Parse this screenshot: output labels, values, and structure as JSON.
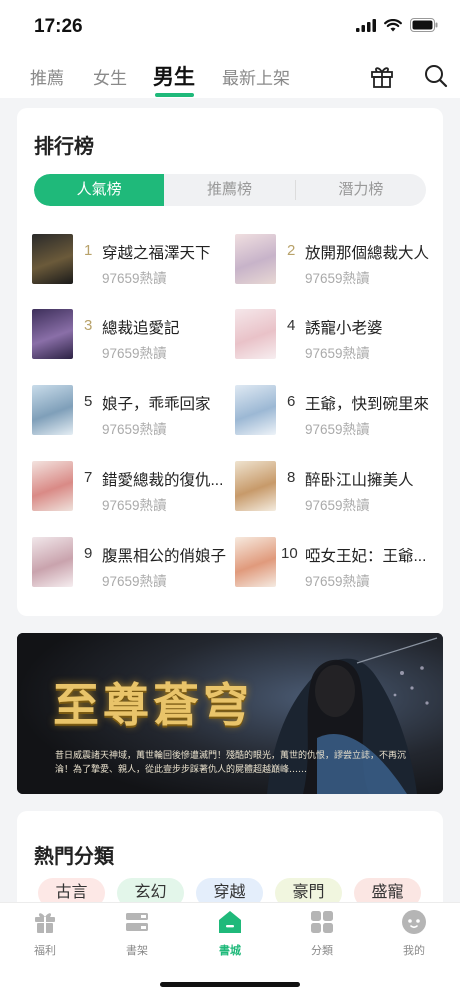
{
  "status": {
    "time": "17:26"
  },
  "top_tabs": [
    {
      "label": "推薦",
      "active": false
    },
    {
      "label": "女生",
      "active": false
    },
    {
      "label": "男生",
      "active": true
    },
    {
      "label": "最新上架",
      "active": false
    }
  ],
  "top_icons": [
    "gift-icon",
    "search-icon"
  ],
  "ranking": {
    "title": "排行榜",
    "segments": [
      {
        "label": "人氣榜",
        "active": true
      },
      {
        "label": "推薦榜",
        "active": false
      },
      {
        "label": "潛力榜",
        "active": false
      }
    ],
    "items": [
      {
        "rank": "1",
        "name": "穿越之福澤天下",
        "reads": "97659熱讀"
      },
      {
        "rank": "2",
        "name": "放開那個總裁大人",
        "reads": "97659熱讀"
      },
      {
        "rank": "3",
        "name": "總裁追愛記",
        "reads": "97659熱讀"
      },
      {
        "rank": "4",
        "name": "誘寵小老婆",
        "reads": "97659熱讀"
      },
      {
        "rank": "5",
        "name": "娘子，乖乖回家",
        "reads": "97659熱讀"
      },
      {
        "rank": "6",
        "name": "王爺，快到碗里來",
        "reads": "97659熱讀"
      },
      {
        "rank": "7",
        "name": "錯愛總裁的復仇...",
        "reads": "97659熱讀"
      },
      {
        "rank": "8",
        "name": "醉卧江山擁美人",
        "reads": "97659熱讀"
      },
      {
        "rank": "9",
        "name": "腹黑相公的俏娘子",
        "reads": "97659熱讀"
      },
      {
        "rank": "10",
        "name": "啞女王妃：王爺...",
        "reads": "97659熱讀"
      }
    ]
  },
  "banner": {
    "title": "至尊蒼穹",
    "description": "昔日威震諸天神域，萬世輪回後慘遭滅門！殘酷的眼光，萬世的仇恨，謬尝立誌，不再沉淪！為了摯愛、親人，從此壹步步踩著仇人的屍體超越巔峰……"
  },
  "categories": {
    "title": "熱門分類",
    "chips": [
      {
        "label": "古言",
        "color": "#fde8e6"
      },
      {
        "label": "玄幻",
        "color": "#e3f6ea"
      },
      {
        "label": "穿越",
        "color": "#e4eefb"
      },
      {
        "label": "豪門",
        "color": "#f1f6df"
      },
      {
        "label": "盛寵",
        "color": "#fbe6e3"
      }
    ]
  },
  "bottom_tabs": [
    {
      "label": "福利",
      "icon": "gift-icon",
      "active": false
    },
    {
      "label": "書架",
      "icon": "bookshelf-icon",
      "active": false
    },
    {
      "label": "書城",
      "icon": "bookstore-home-icon",
      "active": true
    },
    {
      "label": "分類",
      "icon": "category-grid-icon",
      "active": false
    },
    {
      "label": "我的",
      "icon": "profile-icon",
      "active": false
    }
  ],
  "colors": {
    "accent": "#1fb97a",
    "rank_top3": "#b8a26a",
    "muted": "#aaaaaa"
  }
}
